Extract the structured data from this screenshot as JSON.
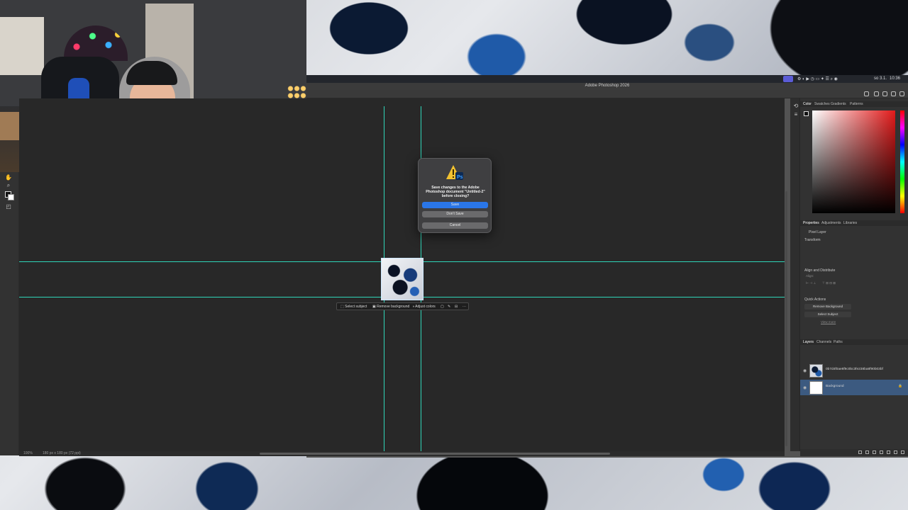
{
  "menubar": {
    "time": "10:36",
    "date": "so 3.1."
  },
  "window": {
    "title": "Adobe Photoshop 2026"
  },
  "toolbar": {
    "tools": [
      "hand",
      "zoom",
      "more",
      "swap-colors",
      "quick-mask",
      "screen-mode"
    ]
  },
  "canvas": {
    "status_zoom": "100%",
    "status_info": "180 px x 180 px (72 ppi)"
  },
  "context_bar": {
    "select_subject": "Select subject",
    "remove_background": "Remove background",
    "adjust_colors": "Adjust colors",
    "more": "···"
  },
  "dialog": {
    "message": "Save changes to the Adobe Photoshop document \"Untitled-2\" before closing?",
    "save": "Save",
    "dont_save": "Don't Save",
    "cancel": "Cancel"
  },
  "color_panel": {
    "tabs": [
      "Color",
      "Swatches",
      "Gradients",
      "Patterns"
    ],
    "hue_color": "#e21a1a"
  },
  "properties_panel": {
    "tabs": [
      "Properties",
      "Adjustments",
      "Libraries"
    ],
    "layer_type": "Pixel Layer",
    "transform": "Transform",
    "align": "Align and Distribute",
    "align_sub": "Align:",
    "quick_actions": "Quick Actions",
    "qa_remove_bg": "Remove Background",
    "qa_select_subject": "Select Subject",
    "qa_view_more": "View more"
  },
  "layers_panel": {
    "tabs": [
      "Layers",
      "Channels",
      "Paths"
    ],
    "layers": [
      {
        "name": "0b7d4f0ae8f9c0bc3fe238ba8f90b03bf",
        "kind": "image"
      },
      {
        "name": "Background",
        "kind": "white",
        "selected": true
      }
    ]
  },
  "colors": {
    "guide": "#2fd6b9",
    "accent": "#2a76e8"
  }
}
